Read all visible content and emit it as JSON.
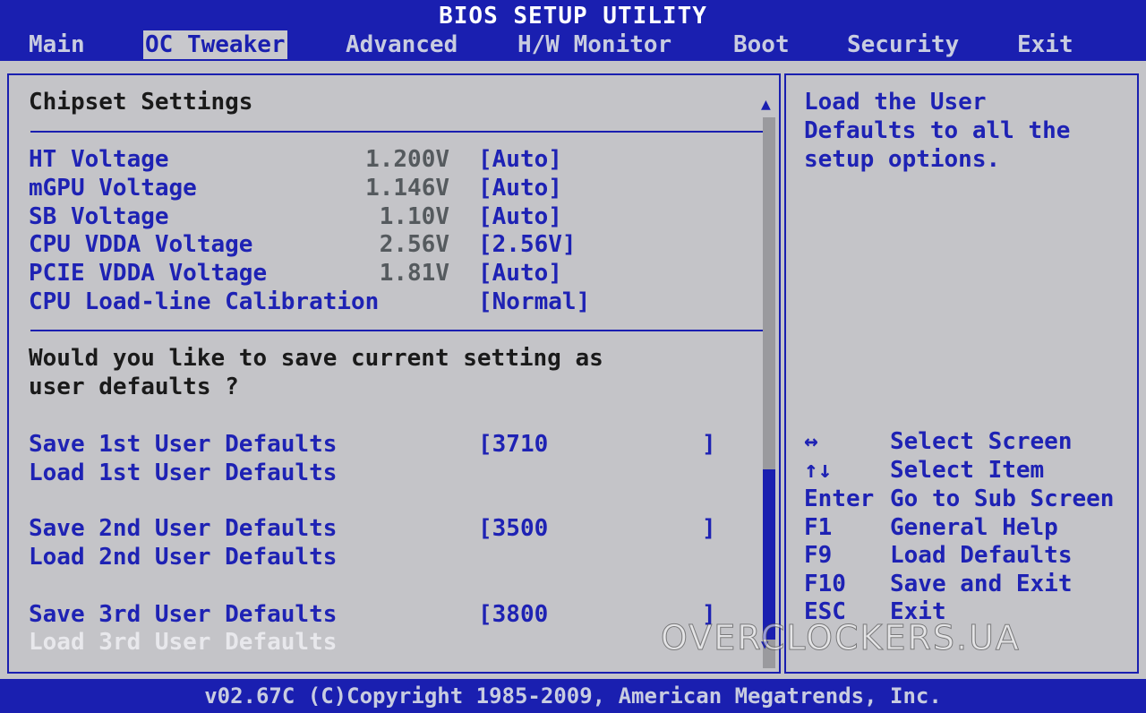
{
  "title": "BIOS SETUP UTILITY",
  "menu": [
    "Main",
    "OC Tweaker",
    "Advanced",
    "H/W Monitor",
    "Boot",
    "Security",
    "Exit"
  ],
  "active_menu": "OC Tweaker",
  "section_title": "Chipset Settings",
  "settings": [
    {
      "label": "HT Voltage",
      "value": "1.200V",
      "option": "[Auto]"
    },
    {
      "label": "mGPU Voltage",
      "value": "1.146V",
      "option": "[Auto]"
    },
    {
      "label": "SB Voltage",
      "value": "1.10V",
      "option": "[Auto]"
    },
    {
      "label": "CPU VDDA Voltage",
      "value": "2.56V",
      "option": "[2.56V]"
    },
    {
      "label": "PCIE VDDA Voltage",
      "value": "1.81V",
      "option": "[Auto]"
    },
    {
      "label": "CPU Load-line Calibration",
      "value": "",
      "option": "[Normal]"
    }
  ],
  "question_line1": "Would you like to save current setting as",
  "question_line2": "user defaults ?",
  "user_defaults": [
    {
      "save_label": "Save 1st User Defaults",
      "save_value": "[3710",
      "close": "]",
      "load_label": "Load 1st User Defaults"
    },
    {
      "save_label": "Save 2nd User Defaults",
      "save_value": "[3500",
      "close": "]",
      "load_label": "Load 2nd User Defaults"
    },
    {
      "save_label": "Save 3rd User Defaults",
      "save_value": "[3800",
      "close": "]",
      "load_label": "Load 3rd User Defaults"
    }
  ],
  "help_text": [
    "Load the User",
    "Defaults to all the",
    "setup options."
  ],
  "keys": [
    {
      "key": "↔",
      "desc": "Select Screen"
    },
    {
      "key": "↑↓",
      "desc": "Select Item"
    },
    {
      "key": "Enter",
      "desc": "Go to Sub Screen"
    },
    {
      "key": "F1",
      "desc": "General Help"
    },
    {
      "key": "F9",
      "desc": "Load Defaults"
    },
    {
      "key": "F10",
      "desc": "Save and Exit"
    },
    {
      "key": "ESC",
      "desc": "Exit"
    }
  ],
  "footer": "v02.67C (C)Copyright 1985-2009, American Megatrends, Inc.",
  "watermark": "OVERCLOCKERS.UA",
  "colors": {
    "background_blue": "#1a1fb0",
    "panel_gray": "#c4c4c8",
    "item_blue": "#1e22b4",
    "value_gray": "#555a5e"
  }
}
